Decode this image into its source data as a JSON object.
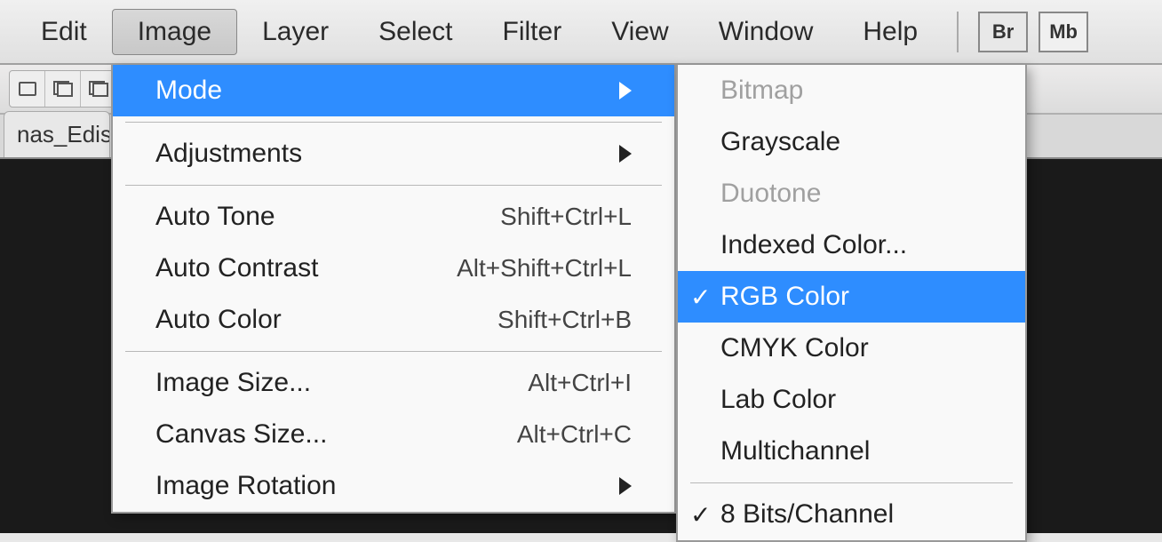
{
  "menubar": {
    "items": [
      "Edit",
      "Image",
      "Layer",
      "Select",
      "Filter",
      "View",
      "Window",
      "Help"
    ],
    "active_index": 1,
    "buttons": [
      "Br",
      "Mb"
    ]
  },
  "tab": {
    "title": "nas_Edis"
  },
  "image_menu": {
    "items": [
      {
        "label": "Mode",
        "shortcut": "",
        "has_submenu": true,
        "highlighted": true
      },
      {
        "separator": true
      },
      {
        "label": "Adjustments",
        "shortcut": "",
        "has_submenu": true
      },
      {
        "separator": true
      },
      {
        "label": "Auto Tone",
        "shortcut": "Shift+Ctrl+L"
      },
      {
        "label": "Auto Contrast",
        "shortcut": "Alt+Shift+Ctrl+L"
      },
      {
        "label": "Auto Color",
        "shortcut": "Shift+Ctrl+B"
      },
      {
        "separator": true
      },
      {
        "label": "Image Size...",
        "shortcut": "Alt+Ctrl+I"
      },
      {
        "label": "Canvas Size...",
        "shortcut": "Alt+Ctrl+C"
      },
      {
        "label": "Image Rotation",
        "shortcut": "",
        "has_submenu": true
      }
    ]
  },
  "mode_menu": {
    "items": [
      {
        "label": "Bitmap",
        "disabled": true
      },
      {
        "label": "Grayscale"
      },
      {
        "label": "Duotone",
        "disabled": true
      },
      {
        "label": "Indexed Color..."
      },
      {
        "label": "RGB Color",
        "checked": true,
        "highlighted": true
      },
      {
        "label": "CMYK Color"
      },
      {
        "label": "Lab Color"
      },
      {
        "label": "Multichannel"
      },
      {
        "separator": true
      },
      {
        "label": "8 Bits/Channel",
        "checked": true
      }
    ]
  }
}
